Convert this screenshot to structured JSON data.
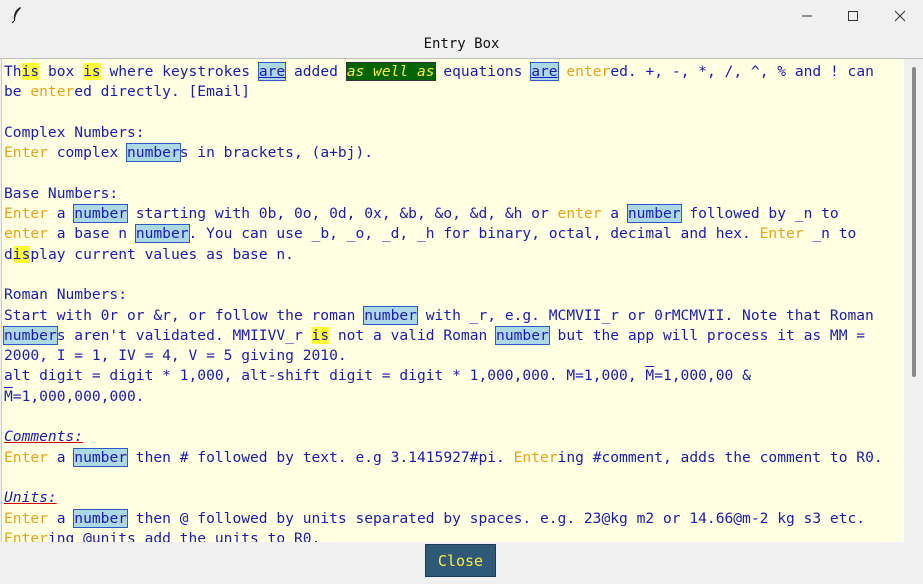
{
  "window": {
    "title": "Entry Box",
    "controls": {
      "minimize": "minimize-icon",
      "maximize": "maximize-icon",
      "close": "close-icon"
    }
  },
  "lines": [
    [
      {
        "t": "Th",
        "c": ""
      },
      {
        "t": "is",
        "c": "hl-yel"
      },
      {
        "t": " box ",
        "c": ""
      },
      {
        "t": "is",
        "c": "hl-yel"
      },
      {
        "t": " where keystrokes ",
        "c": ""
      },
      {
        "t": "are",
        "c": "hl-are"
      },
      {
        "t": " added ",
        "c": ""
      },
      {
        "t": "as well as",
        "c": "hl-green"
      },
      {
        "t": " equations ",
        "c": ""
      },
      {
        "t": "are",
        "c": "hl-are"
      },
      {
        "t": " ",
        "c": ""
      },
      {
        "t": "enter",
        "c": "orange"
      },
      {
        "t": "ed. +, -, *, /, ^, % and ! can",
        "c": ""
      }
    ],
    [
      {
        "t": "be ",
        "c": ""
      },
      {
        "t": "enter",
        "c": "orange"
      },
      {
        "t": "ed directly. [Email]",
        "c": ""
      }
    ],
    [],
    [
      {
        "t": "Complex Numbers:",
        "c": ""
      }
    ],
    [
      {
        "t": "Enter",
        "c": "orange"
      },
      {
        "t": " complex ",
        "c": ""
      },
      {
        "t": "number",
        "c": "hl-num"
      },
      {
        "t": "s in brackets, (a+bj).",
        "c": ""
      }
    ],
    [],
    [
      {
        "t": "Base Numbers:",
        "c": ""
      }
    ],
    [
      {
        "t": "Enter",
        "c": "orange"
      },
      {
        "t": " a ",
        "c": ""
      },
      {
        "t": "number",
        "c": "hl-num"
      },
      {
        "t": " starting with 0b, 0o, 0d, 0x, &b, &o, &d, &h or ",
        "c": ""
      },
      {
        "t": "enter",
        "c": "orange"
      },
      {
        "t": " a ",
        "c": ""
      },
      {
        "t": "number",
        "c": "hl-num"
      },
      {
        "t": " followed by _n to",
        "c": ""
      }
    ],
    [
      {
        "t": "enter",
        "c": "orange"
      },
      {
        "t": " a base n ",
        "c": ""
      },
      {
        "t": "number",
        "c": "hl-num"
      },
      {
        "t": ". You can use _b, _o, _d, _h for binary, octal, decimal and hex. ",
        "c": ""
      },
      {
        "t": "Enter",
        "c": "orange"
      },
      {
        "t": " _n to",
        "c": ""
      }
    ],
    [
      {
        "t": "d",
        "c": ""
      },
      {
        "t": "is",
        "c": "hl-yel"
      },
      {
        "t": "play current values as base n.",
        "c": ""
      }
    ],
    [],
    [
      {
        "t": "Roman Numbers:",
        "c": ""
      }
    ],
    [
      {
        "t": "Start with 0r or &r, or follow the roman ",
        "c": ""
      },
      {
        "t": "number",
        "c": "hl-num"
      },
      {
        "t": " with _r, e.g. MCMVII_r or 0rMCMVII. Note that Roman",
        "c": ""
      }
    ],
    [
      {
        "t": "number",
        "c": "hl-num"
      },
      {
        "t": "s aren't validated. MMIIVV_r ",
        "c": ""
      },
      {
        "t": "is",
        "c": "hl-yel"
      },
      {
        "t": " not a valid Roman ",
        "c": ""
      },
      {
        "t": "number",
        "c": "hl-num"
      },
      {
        "t": " but the app will process it as MM =",
        "c": ""
      }
    ],
    [
      {
        "t": "2000, I = 1, IV = 4, V = 5 giving 2010.",
        "c": ""
      }
    ],
    [
      {
        "t": "alt digit = digit * 1,000, alt-shift digit = digit * 1,000,000. M=1,000, ",
        "c": ""
      },
      {
        "t": "M",
        "c": "overline"
      },
      {
        "t": "=1,000,00 &",
        "c": ""
      }
    ],
    [
      {
        "t": "M",
        "c": "overline"
      },
      {
        "t": "=1,000,000,000.",
        "c": ""
      }
    ],
    [],
    [
      {
        "t": "Comments:",
        "c": "heading"
      }
    ],
    [
      {
        "t": "Enter",
        "c": "orange"
      },
      {
        "t": " a ",
        "c": ""
      },
      {
        "t": "number",
        "c": "hl-num"
      },
      {
        "t": " then # followed by text. e.g 3.1415927#pi. ",
        "c": ""
      },
      {
        "t": "Enter",
        "c": "orange"
      },
      {
        "t": "ing #comment, adds the comment to R0.",
        "c": ""
      }
    ],
    [],
    [
      {
        "t": "Units:",
        "c": "heading"
      }
    ],
    [
      {
        "t": "Enter",
        "c": "orange"
      },
      {
        "t": " a ",
        "c": ""
      },
      {
        "t": "number",
        "c": "hl-num"
      },
      {
        "t": " then @ followed by units separated by spaces. e.g. 23@kg m2 or 14.66@m-2 kg s3 etc.",
        "c": ""
      }
    ],
    [
      {
        "t": "Enter",
        "c": "orange"
      },
      {
        "t": "ing @units add the units to R0.",
        "c": ""
      }
    ]
  ],
  "buttons": {
    "close_label": "Close"
  },
  "colors": {
    "text": "#1a1ab8",
    "keyword_orange": "#e8a317",
    "background": "#ffffe1",
    "highlight_blue": "#add8e6",
    "highlight_yellow": "#ffff33",
    "highlight_green": "#006400",
    "button_bg": "#2e5a78",
    "button_text": "#ffeb3b"
  }
}
